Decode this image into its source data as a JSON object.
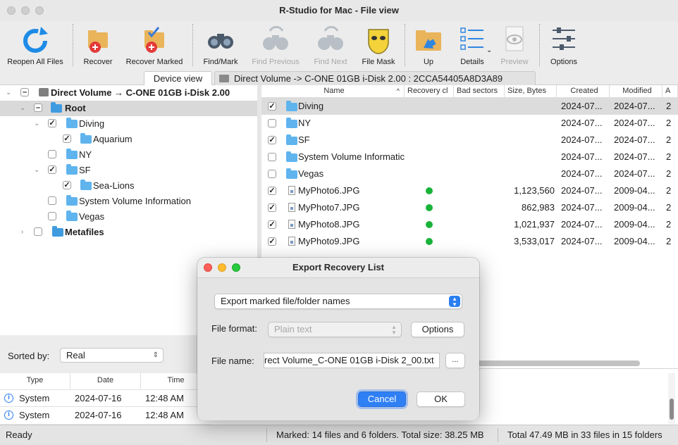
{
  "window": {
    "title": "R-Studio for Mac - File view"
  },
  "toolbar": {
    "reopen": "Reopen All Files",
    "recover": "Recover",
    "recover_marked": "Recover Marked",
    "find_mark": "Find/Mark",
    "find_previous": "Find Previous",
    "find_next": "Find Next",
    "file_mask": "File Mask",
    "up": "Up",
    "details": "Details",
    "preview": "Preview",
    "options": "Options"
  },
  "tabs": {
    "device_view": "Device view",
    "path": "Direct Volume -> C-ONE 01GB i-Disk 2.00 : 2CCA54405A8D3A89"
  },
  "tree": {
    "volume": "Direct Volume → C-ONE 01GB i-Disk 2.00",
    "root": "Root",
    "diving": "Diving",
    "aquarium": "Aquarium",
    "ny": "NY",
    "sf": "SF",
    "sea_lions": "Sea-Lions",
    "svi": "System Volume Information",
    "vegas": "Vegas",
    "metafiles": "Metafiles"
  },
  "sort": {
    "label": "Sorted by:",
    "value": "Real"
  },
  "log": {
    "headers": [
      "Type",
      "Date",
      "Time"
    ],
    "rows": [
      {
        "type": "System",
        "date": "2024-07-16",
        "time": "12:48 AM"
      },
      {
        "type": "System",
        "date": "2024-07-16",
        "time": "12:48 AM"
      }
    ]
  },
  "list": {
    "headers": {
      "name": "Name",
      "recovery": "Recovery cl",
      "bad": "Bad sectors",
      "size": "Size, Bytes",
      "created": "Created",
      "modified": "Modified",
      "a": "A"
    },
    "rows": [
      {
        "name": "Diving",
        "size": "",
        "created": "2024-07...",
        "modified": "2024-07...",
        "a": "2"
      },
      {
        "name": "NY",
        "size": "",
        "created": "2024-07...",
        "modified": "2024-07...",
        "a": "2"
      },
      {
        "name": "SF",
        "size": "",
        "created": "2024-07...",
        "modified": "2024-07...",
        "a": "2"
      },
      {
        "name": "System Volume Informatic",
        "size": "",
        "created": "2024-07...",
        "modified": "2024-07...",
        "a": "2"
      },
      {
        "name": "Vegas",
        "size": "",
        "created": "2024-07...",
        "modified": "2024-07...",
        "a": "2"
      },
      {
        "name": "MyPhoto6.JPG",
        "size": "1,123,560",
        "created": "2024-07...",
        "modified": "2009-04...",
        "a": "2"
      },
      {
        "name": "MyPhoto7.JPG",
        "size": "862,983",
        "created": "2024-07...",
        "modified": "2009-04...",
        "a": "2"
      },
      {
        "name": "MyPhoto8.JPG",
        "size": "1,021,937",
        "created": "2024-07...",
        "modified": "2009-04...",
        "a": "2"
      },
      {
        "name": "MyPhoto9.JPG",
        "size": "3,533,017",
        "created": "2024-07...",
        "modified": "2009-04...",
        "a": "2"
      }
    ]
  },
  "status": {
    "ready": "Ready",
    "marked": "Marked: 14 files and 6 folders. Total size: 38.25 MB",
    "total": "Total 47.49 MB in 33 files in 15 folders"
  },
  "dialog": {
    "title": "Export Recovery List",
    "export_mode": "Export marked file/folder names",
    "file_format_label": "File format:",
    "file_format_value": "Plain text",
    "options_btn": "Options",
    "file_name_label": "File name:",
    "file_name_value": "rect Volume_C-ONE 01GB i-Disk 2_00.txt",
    "browse_btn": "...",
    "cancel_btn": "Cancel",
    "ok_btn": "OK"
  },
  "colors": {
    "accent": "#2f7ff5",
    "folder": "#5fb4ee",
    "ok_dot": "#19b339"
  }
}
